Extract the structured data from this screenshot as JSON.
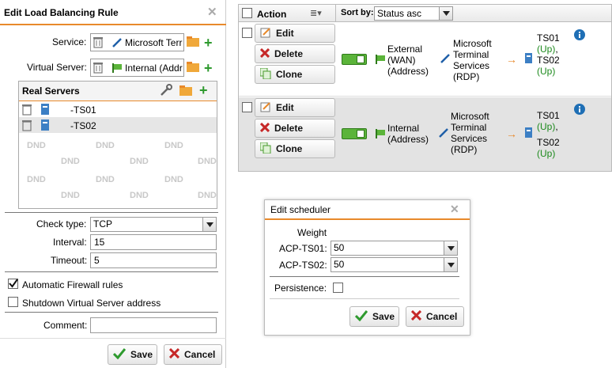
{
  "left_panel": {
    "title": "Edit Load Balancing Rule",
    "service_label": "Service:",
    "service_value": "Microsoft Terr",
    "virtual_server_label": "Virtual Server:",
    "virtual_server_value": "Internal (Addr",
    "real_servers_title": "Real Servers",
    "real_servers": [
      {
        "name": "ACP-TS01",
        "display": "-TS01"
      },
      {
        "name": "ACP-TS02",
        "display": "-TS02"
      }
    ],
    "dnd_text": "DND",
    "check_type_label": "Check type:",
    "check_type_value": "TCP",
    "interval_label": "Interval:",
    "interval_value": "15",
    "timeout_label": "Timeout:",
    "timeout_value": "5",
    "auto_firewall_label": "Automatic Firewall rules",
    "auto_firewall_checked": true,
    "shutdown_label": "Shutdown Virtual Server address",
    "shutdown_checked": false,
    "comment_label": "Comment:",
    "comment_value": "",
    "save_label": "Save",
    "cancel_label": "Cancel"
  },
  "list_panel": {
    "action_header": "Action",
    "sortby_label": "Sort by:",
    "sortby_value": "Status asc",
    "rows": [
      {
        "edit": "Edit",
        "delete": "Delete",
        "clone": "Clone",
        "virtual_server": "External (WAN) (Address)",
        "service": "Microsoft Terminal Services (RDP)",
        "servers": [
          {
            "name": "TS01",
            "status": "(Up)",
            "sep": ","
          },
          {
            "name": "TS02",
            "status": "(Up)",
            "sep": ""
          }
        ]
      },
      {
        "edit": "Edit",
        "delete": "Delete",
        "clone": "Clone",
        "virtual_server": "Internal (Address)",
        "service": "Microsoft Terminal Services (RDP)",
        "servers": [
          {
            "name": "TS01",
            "status": "(Up)",
            "sep": ","
          },
          {
            "name": "TS02",
            "status": "(Up)",
            "sep": ""
          }
        ]
      }
    ]
  },
  "scheduler": {
    "title": "Edit scheduler",
    "weight_label": "Weight",
    "ts01_label": "ACP-TS01:",
    "ts01_value": "50",
    "ts02_label": "ACP-TS02:",
    "ts02_value": "50",
    "persistence_label": "Persistence:",
    "save_label": "Save",
    "cancel_label": "Cancel"
  },
  "colors": {
    "accent": "#e8892b",
    "ok_green": "#1d8a1d",
    "cancel_red": "#c62828",
    "info_blue": "#1f6fb5"
  }
}
